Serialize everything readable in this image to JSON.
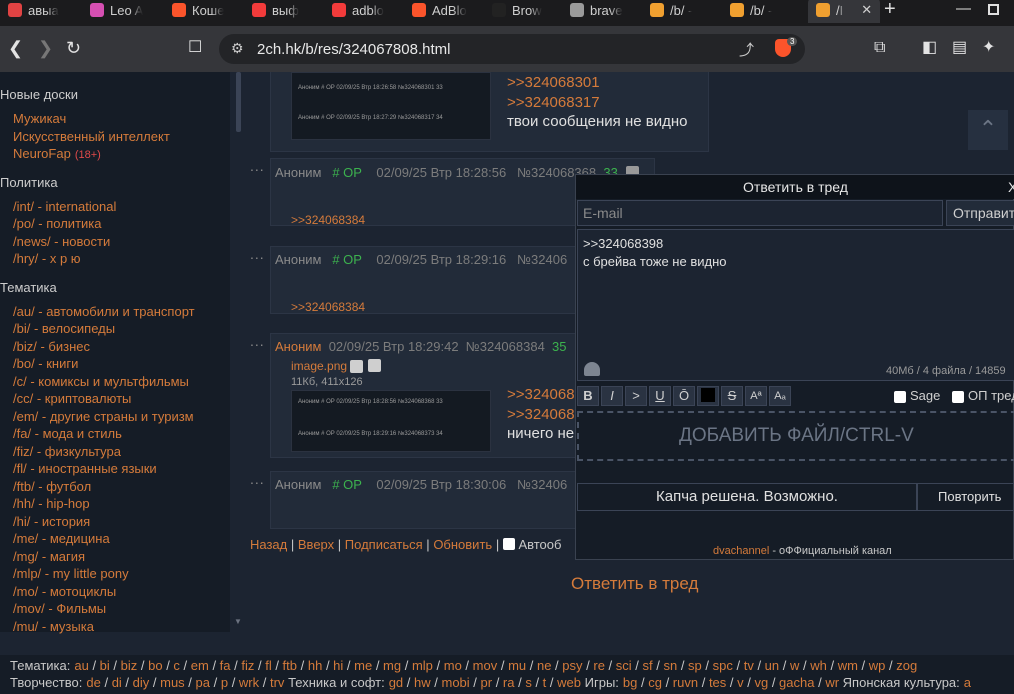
{
  "tabs": [
    {
      "label": "авыа",
      "icon_color": "#e04343"
    },
    {
      "label": "Leo A",
      "icon_color": "#d64fb2"
    },
    {
      "label": "Коше",
      "icon_color": "#fb542b"
    },
    {
      "label": "выф",
      "icon_color": "#f23b3b"
    },
    {
      "label": "adblo",
      "icon_color": "#f23b3b"
    },
    {
      "label": "AdBlo",
      "icon_color": "#fb542b"
    },
    {
      "label": "Brow",
      "icon_color": "#222222"
    },
    {
      "label": "brave",
      "icon_color": "#9a9a9a"
    },
    {
      "label": "/b/ -",
      "icon_color": "#f0a030"
    },
    {
      "label": "/b/ -",
      "icon_color": "#f0a030"
    },
    {
      "label": "/I",
      "icon_color": "#f0a030"
    }
  ],
  "new_tab_label": "+",
  "address": {
    "url": "2ch.hk/b/res/324067808.html",
    "shield_badge": "3"
  },
  "sidebar": {
    "sections": [
      {
        "title": "Новые доски",
        "items": [
          {
            "label": "Мужикач"
          },
          {
            "label": "Искусственный интеллект"
          },
          {
            "label": "NeuroFap",
            "tag": "(18+)"
          }
        ]
      },
      {
        "title": "Политика",
        "items": [
          {
            "label": "/int/ - international"
          },
          {
            "label": "/po/ - политика"
          },
          {
            "label": "/news/ - новости"
          },
          {
            "label": "/hry/ - х р ю"
          }
        ]
      },
      {
        "title": "Тематика",
        "items": [
          {
            "label": "/au/ - автомобили и транспорт"
          },
          {
            "label": "/bi/ - велосипеды"
          },
          {
            "label": "/biz/ - бизнес"
          },
          {
            "label": "/bo/ - книги"
          },
          {
            "label": "/c/ - комиксы и мультфильмы"
          },
          {
            "label": "/cc/ - криптовалюты"
          },
          {
            "label": "/em/ - другие страны и туризм"
          },
          {
            "label": "/fa/ - мода и стиль"
          },
          {
            "label": "/fiz/ - физкультура"
          },
          {
            "label": "/fl/ - иностранные языки"
          },
          {
            "label": "/ftb/ - футбол"
          },
          {
            "label": "/hh/ - hip-hop"
          },
          {
            "label": "/hi/ - история"
          },
          {
            "label": "/me/ - медицина"
          },
          {
            "label": "/mg/ - магия"
          },
          {
            "label": "/mlp/ - my little pony"
          },
          {
            "label": "/mo/ - мотоциклы"
          },
          {
            "label": "/mov/ - Фильмы"
          },
          {
            "label": "/mu/ - музыка"
          }
        ]
      }
    ]
  },
  "posts": {
    "p0": {
      "ref1": ">>324068301",
      "ref2": ">>324068317",
      "text": "твои сообщения не видно",
      "thumb_rows": [
        "Аноним # OP 02/09/25 Втр 18:26:58 №324068301 33",
        "Аноним # OP 02/09/25 Втр 18:27:29 №324068317 34"
      ]
    },
    "p1": {
      "dots": "...",
      "anon": "Аноним",
      "op": "# OP",
      "date": "02/09/25 Втр 18:28:56",
      "num": "№324068368",
      "count": "33",
      "link": ">>324068384"
    },
    "p2": {
      "dots": "...",
      "anon": "Аноним",
      "op": "# OP",
      "date": "02/09/25 Втр 18:29:16",
      "num": "№32406",
      "link": ">>324068384"
    },
    "p3": {
      "dots": "...",
      "anon": "Аноним",
      "date": "02/09/25 Втр 18:29:42",
      "num": "№324068384",
      "count": "35",
      "file": "image.png",
      "filemeta": "11Кб, 411x126",
      "ref1": ">>324068",
      "ref2": ">>324068",
      "text": "ничего не",
      "thumb_rows": [
        "Аноним # OP 02/09/25 Втр 18:28:56 №324068368 33",
        "Аноним # OP 02/09/25 Втр 18:29:16 №324068373 34"
      ]
    },
    "p4": {
      "dots": "...",
      "anon": "Аноним",
      "op": "# OP",
      "date": "02/09/25 Втр 18:30:06",
      "num": "№32406"
    }
  },
  "nav": {
    "back": "Назад",
    "up": "Вверх",
    "subscribe": "Подписаться",
    "refresh": "Обновить",
    "auto": "Автооб",
    "sep": "|"
  },
  "reply_link": "Ответить в тред",
  "reply_form": {
    "title": "Ответить в тред",
    "close": "X",
    "email_placeholder": "E-mail",
    "send": "Отправить",
    "message_line1": ">>324068398",
    "message_line2": "с брейва тоже не видно",
    "limits": "40Мб / 4 файла / 14859",
    "format_buttons": [
      "B",
      "I",
      ">",
      "U",
      "Ō",
      "■",
      "S",
      "Aª",
      "Aₐ"
    ],
    "sage": "Sage",
    "op_thread": "ОП тред",
    "add_file": "ДОБАВИТЬ ФАЙЛ/CTRL-V",
    "captcha": "Капча решена. Возможно.",
    "retry": "Повторить",
    "channel_link": "dvachannel",
    "channel_text": " - оФФициальный канал"
  },
  "footer": {
    "line1_label": "Тематика:",
    "line1": [
      "au",
      "bi",
      "biz",
      "bo",
      "c",
      "em",
      "fa",
      "fiz",
      "fl",
      "ftb",
      "hh",
      "hi",
      "me",
      "mg",
      "mlp",
      "mo",
      "mov",
      "mu",
      "ne",
      "psy",
      "re",
      "sci",
      "sf",
      "sn",
      "sp",
      "spc",
      "tv",
      "un",
      "w",
      "wh",
      "wm",
      "wp",
      "zog"
    ],
    "line2_label": "Творчество:",
    "line2a": [
      "de",
      "di",
      "diy",
      "mus",
      "pa",
      "p",
      "wrk",
      "trv"
    ],
    "line2_tech": "Техника и софт:",
    "line2b": [
      "gd",
      "hw",
      "mobi",
      "pr",
      "ra",
      "s",
      "t",
      "web"
    ],
    "line2_games": "Игры:",
    "line2c": [
      "bg",
      "cg",
      "ruvn",
      "tes",
      "v",
      "vg",
      "gacha",
      "wr"
    ],
    "line2_jp": "Японская культура:",
    "line2d": [
      "a"
    ]
  }
}
